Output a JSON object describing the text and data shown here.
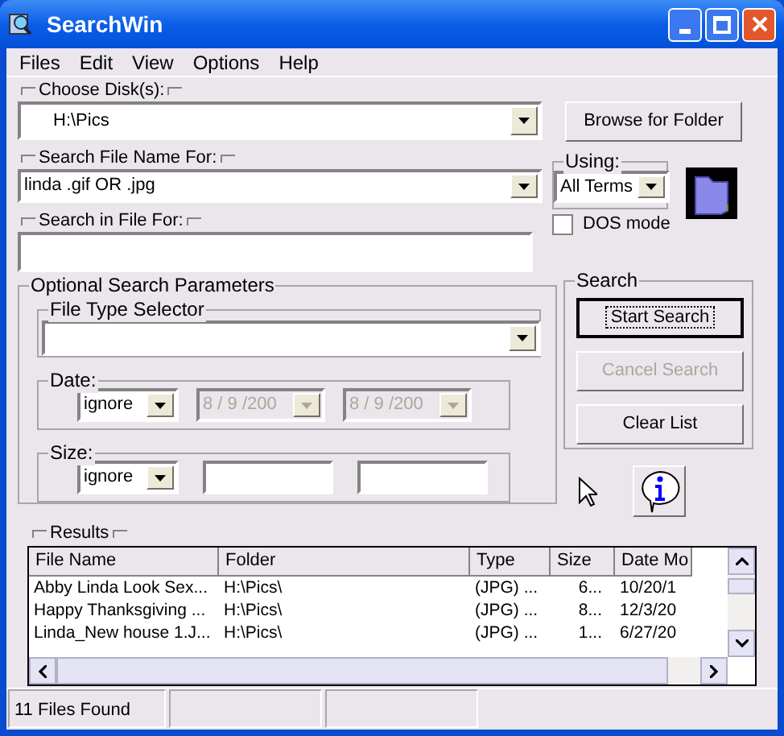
{
  "window": {
    "title": "SearchWin"
  },
  "menu": [
    "Files",
    "Edit",
    "View",
    "Options",
    "Help"
  ],
  "choose_disk": {
    "label": "Choose Disk(s):",
    "value": "H:\\Pics"
  },
  "browse_button": {
    "label": "Browse for Folder"
  },
  "file_name": {
    "label": "Search File Name For:",
    "value": "linda .gif OR .jpg"
  },
  "using": {
    "label": "Using:",
    "value": "All Terms"
  },
  "dos_mode": {
    "label": "DOS mode",
    "checked": false
  },
  "search_in_file": {
    "label": "Search in File For:"
  },
  "optional": {
    "label": "Optional Search Parameters",
    "file_type_label": "File Type Selector",
    "date": {
      "label": "Date:",
      "mode": "ignore",
      "from": "8 / 9 /200",
      "to": "8 / 9 /200",
      "disabled": true
    },
    "size": {
      "label": "Size:",
      "mode": "ignore"
    }
  },
  "search_group": {
    "label": "Search",
    "buttons": [
      {
        "label": "Start Search",
        "default": true,
        "disabled": false
      },
      {
        "label": "Cancel Search",
        "default": false,
        "disabled": true
      },
      {
        "label": "Clear List",
        "default": false,
        "disabled": false
      }
    ]
  },
  "results": {
    "label": "Results",
    "columns": [
      "File Name",
      "Folder",
      "Type",
      "Size",
      "Date Mo"
    ],
    "rows": [
      [
        "Abby  Linda Look Sex...",
        "H:\\Pics\\",
        "(JPG) ...",
        "6...",
        "10/20/1"
      ],
      [
        "Happy Thanksgiving ...",
        "H:\\Pics\\",
        "(JPG) ...",
        "8...",
        "12/3/20"
      ],
      [
        "Linda_New house 1.J...",
        "H:\\Pics\\",
        "(JPG) ...",
        "1...",
        "6/27/20"
      ]
    ]
  },
  "status_bar": [
    "11 Files Found"
  ]
}
